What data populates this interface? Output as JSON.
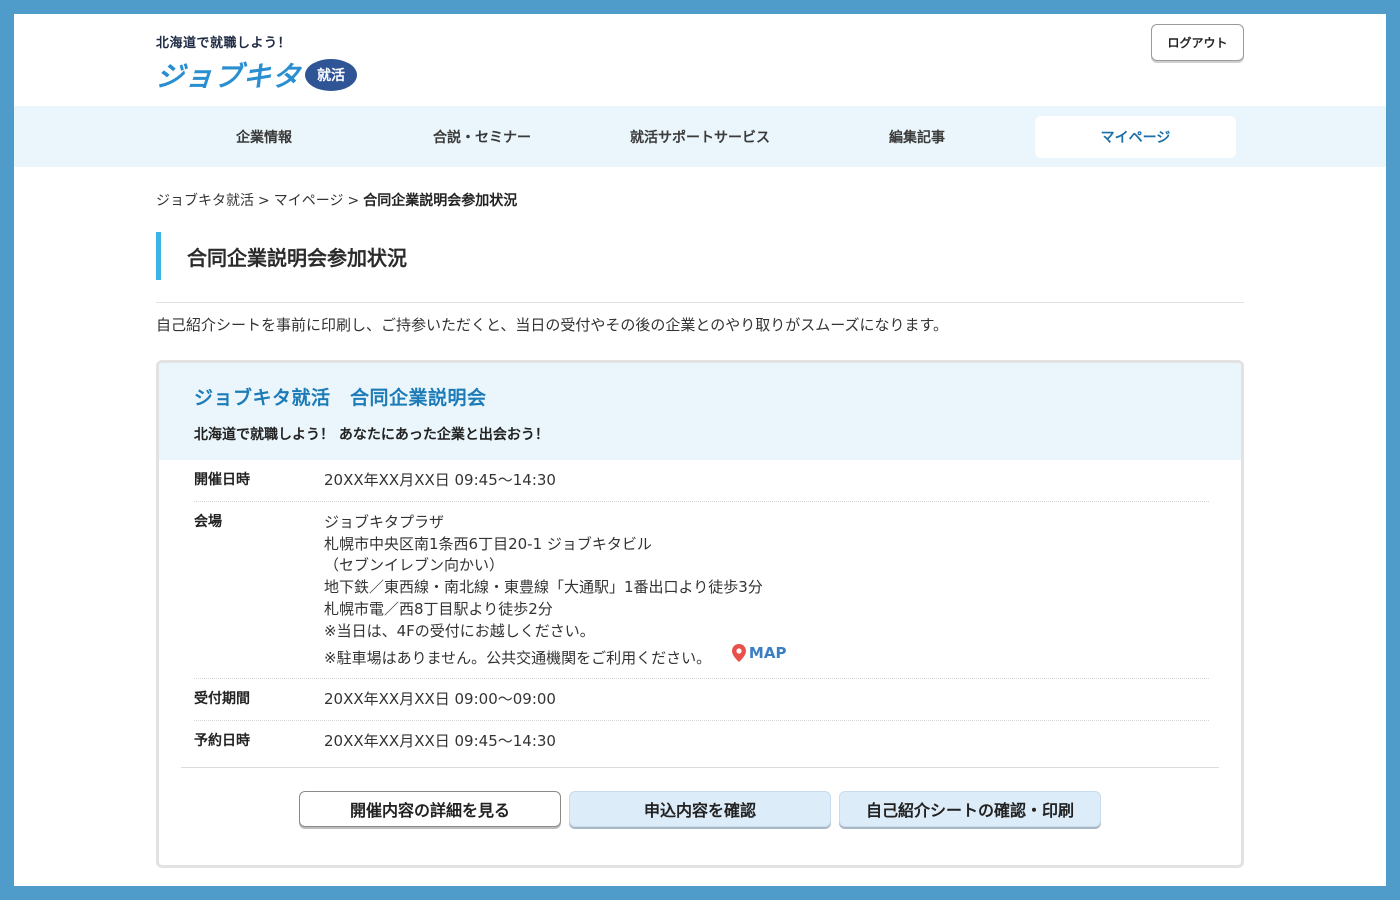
{
  "header": {
    "tagline": "北海道で就職しよう！",
    "logo_text": "ジョブキタ",
    "logo_badge": "就活",
    "logout_label": "ログアウト"
  },
  "nav": {
    "items": [
      {
        "label": "企業情報",
        "active": false
      },
      {
        "label": "合説・セミナー",
        "active": false
      },
      {
        "label": "就活サポートサービス",
        "active": false
      },
      {
        "label": "編集記事",
        "active": false
      },
      {
        "label": "マイページ",
        "active": true
      }
    ]
  },
  "breadcrumb": {
    "items": [
      "ジョブキタ就活",
      "マイページ",
      "合同企業説明会参加状況"
    ],
    "separator": ">"
  },
  "page": {
    "title": "合同企業説明会参加状況",
    "intro": "自己紹介シートを事前に印刷し、ご持参いただくと、当日の受付やその後の企業とのやり取りがスムーズになります。"
  },
  "event": {
    "title": "ジョブキタ就活　合同企業説明会",
    "subtitle": "北海道で就職しよう！ あなたにあった企業と出会おう！",
    "date": {
      "label": "開催日時",
      "value": "20XX年XX月XX日 09:45〜14:30"
    },
    "venue": {
      "label": "会場",
      "lines": [
        "ジョブキタプラザ",
        "札幌市中央区南1条西6丁目20-1 ジョブキタビル",
        "（セブンイレブン向かい）",
        "地下鉄／東西線・南北線・東豊線「大通駅」1番出口より徒歩3分",
        "札幌市電／西8丁目駅より徒歩2分",
        "※当日は、4Fの受付にお越しください。",
        "※駐車場はありません。公共交通機関をご利用ください。"
      ],
      "map_label": "MAP"
    },
    "reception": {
      "label": "受付期間",
      "value": "20XX年XX月XX日 09:00〜09:00"
    },
    "reservation": {
      "label": "予約日時",
      "value": "20XX年XX月XX日 09:45〜14:30"
    }
  },
  "buttons": {
    "details": "開催内容の詳細を見る",
    "confirm": "申込内容を確認",
    "sheet": "自己紹介シートの確認・印刷"
  },
  "colors": {
    "frame": "#4f9ccb",
    "nav_bg": "#eaf6fb",
    "accent": "#3cb4e6",
    "event_title": "#1d7cb8",
    "map_pin": "#e8504a"
  }
}
